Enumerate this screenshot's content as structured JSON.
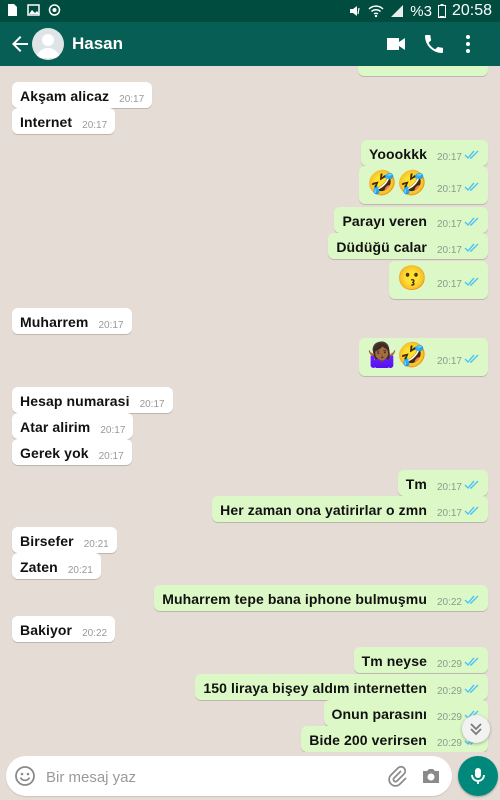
{
  "status": {
    "battery": "%3",
    "time": "20:58"
  },
  "header": {
    "contact_name": "Hasan"
  },
  "messages": [
    {
      "dir": "out",
      "text": "",
      "time": "",
      "partial": true
    },
    {
      "dir": "in",
      "text": "Akşam alicaz",
      "time": "20:17"
    },
    {
      "dir": "in",
      "text": "Internet",
      "time": "20:17"
    },
    {
      "dir": "out",
      "text": "Yoookkk",
      "time": "20:17"
    },
    {
      "dir": "out",
      "text": "🤣🤣",
      "time": "20:17",
      "emoji": true
    },
    {
      "dir": "out",
      "text": "Parayı veren",
      "time": "20:17"
    },
    {
      "dir": "out",
      "text": "Düdüğü calar",
      "time": "20:17"
    },
    {
      "dir": "out",
      "text": "😗",
      "time": "20:17",
      "emoji": true
    },
    {
      "dir": "in",
      "text": "Muharrem",
      "time": "20:17"
    },
    {
      "dir": "out",
      "text": "🤷🏾‍♀️🤣",
      "time": "20:17",
      "emoji": true
    },
    {
      "dir": "in",
      "text": "Hesap numarasi",
      "time": "20:17"
    },
    {
      "dir": "in",
      "text": "Atar alirim",
      "time": "20:17"
    },
    {
      "dir": "in",
      "text": "Gerek yok",
      "time": "20:17"
    },
    {
      "dir": "out",
      "text": "Tm",
      "time": "20:17"
    },
    {
      "dir": "out",
      "text": "Her zaman ona yatirirlar o zmn",
      "time": "20:17"
    },
    {
      "dir": "in",
      "text": "Birsefer",
      "time": "20:21"
    },
    {
      "dir": "in",
      "text": "Zaten",
      "time": "20:21"
    },
    {
      "dir": "out",
      "text": "Muharrem tepe bana iphone bulmuşmu",
      "time": "20:22"
    },
    {
      "dir": "in",
      "text": "Bakiyor",
      "time": "20:22"
    },
    {
      "dir": "out",
      "text": "Tm neyse",
      "time": "20:29"
    },
    {
      "dir": "out",
      "text": "150 liraya bişey aldım internetten",
      "time": "20:29"
    },
    {
      "dir": "out",
      "text": "Onun parasını",
      "time": "20:29"
    },
    {
      "dir": "out",
      "text": "Bide 200 verirsen",
      "time": "20:29"
    }
  ],
  "composer": {
    "placeholder": "Bir mesaj yaz"
  },
  "icons": {
    "back": "arrow-left-icon",
    "video": "video-camera-icon",
    "call": "phone-icon",
    "menu": "more-vert-icon",
    "emoji": "smiley-icon",
    "attach": "paperclip-icon",
    "camera": "camera-icon",
    "mic": "microphone-icon",
    "scroll": "chevron-double-down-icon",
    "ticks": "double-check-icon"
  },
  "colors": {
    "header": "#075e54",
    "statusbar": "#004d40",
    "incoming": "#ffffff",
    "outgoing": "#dcf8c6",
    "read_ticks": "#4fc3f7",
    "mic": "#00897b",
    "chat_bg": "#e5ddd5"
  }
}
